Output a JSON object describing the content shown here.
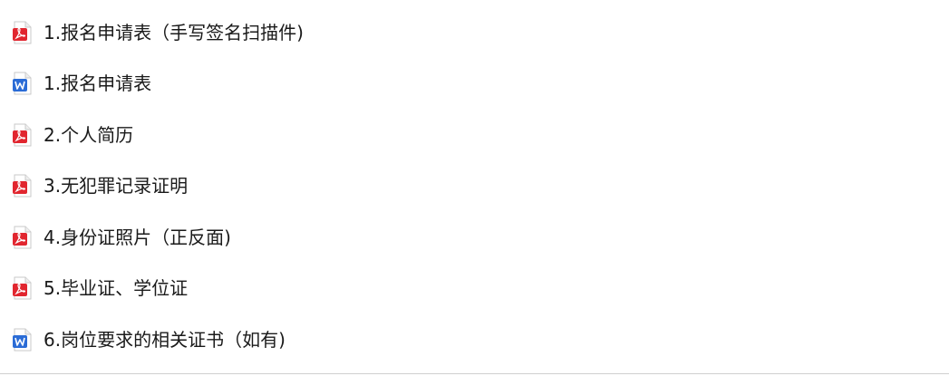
{
  "files": [
    {
      "name": "1.报名申请表（手写签名扫描件)",
      "type": "pdf",
      "icon": "pdf-file-icon"
    },
    {
      "name": "1.报名申请表",
      "type": "word",
      "icon": "word-file-icon"
    },
    {
      "name": "2.个人简历",
      "type": "pdf",
      "icon": "pdf-file-icon"
    },
    {
      "name": "3.无犯罪记录证明",
      "type": "pdf",
      "icon": "pdf-file-icon"
    },
    {
      "name": "4.身份证照片（正反面)",
      "type": "pdf",
      "icon": "pdf-file-icon"
    },
    {
      "name": "5.毕业证、学位证",
      "type": "pdf",
      "icon": "pdf-file-icon"
    },
    {
      "name": "6.岗位要求的相关证书（如有)",
      "type": "word",
      "icon": "word-file-icon"
    }
  ],
  "colors": {
    "pdf_accent": "#e1262f",
    "word_accent": "#2b6cd6",
    "text": "#1a1a1a"
  }
}
